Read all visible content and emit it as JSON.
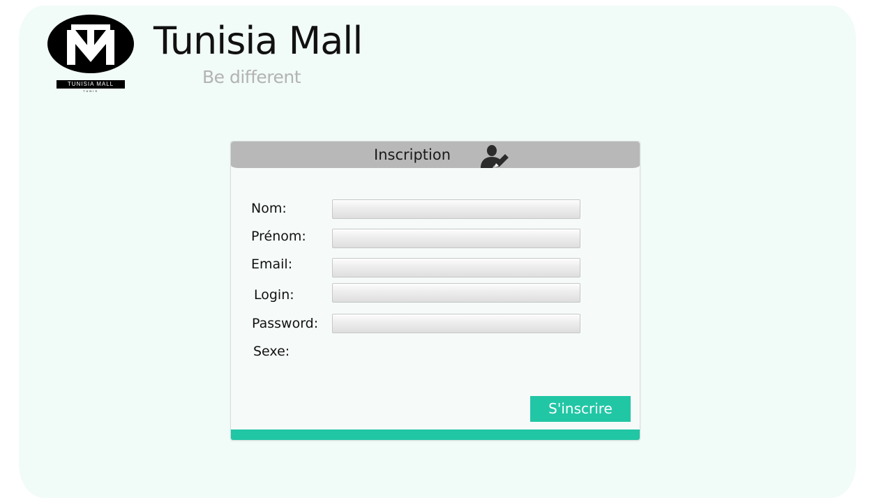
{
  "brand": {
    "title": "Tunisia Mall",
    "tagline": "Be different",
    "logo_text": "TUNISIA MALL",
    "logo_subtext": "TUNIS",
    "logo_icon": "tm-monogram-logo"
  },
  "form": {
    "title": "Inscription",
    "header_icon": "user-edit-icon",
    "fields": [
      {
        "label": "Nom:",
        "value": "",
        "placeholder": ""
      },
      {
        "label": "Prénom:",
        "value": "",
        "placeholder": ""
      },
      {
        "label": "Email:",
        "value": "",
        "placeholder": ""
      },
      {
        "label": "Login:",
        "value": "",
        "placeholder": ""
      },
      {
        "label": "Password:",
        "value": "",
        "placeholder": ""
      }
    ],
    "sexe_label": "Sexe:",
    "submit_label": "S'inscrire"
  },
  "colors": {
    "page_background": "#f1fbf8",
    "accent": "#21c6a5",
    "header_gray": "#b8b8b8",
    "tagline_gray": "#b3b3b3"
  }
}
